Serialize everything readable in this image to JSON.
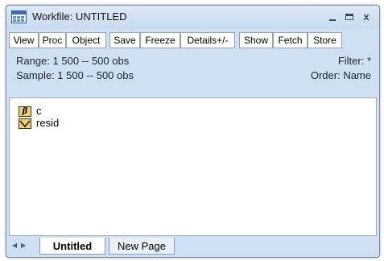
{
  "window": {
    "title": "Workfile: UNTITLED",
    "controls": {
      "minimize": "_",
      "maximize": "□",
      "close": "X"
    }
  },
  "toolbar": {
    "buttons": [
      {
        "label": "View"
      },
      {
        "label": "Proc"
      },
      {
        "label": "Object"
      },
      {
        "label": "Save"
      },
      {
        "label": "Freeze"
      },
      {
        "label": "Details+/-"
      },
      {
        "label": "Show"
      },
      {
        "label": "Fetch"
      },
      {
        "label": "Store"
      }
    ]
  },
  "info": {
    "range": "Range:  1 500  --  500 obs",
    "sample": "Sample: 1 500  --  500 obs",
    "filter": "Filter: *",
    "order": "Order: Name"
  },
  "objects": [
    {
      "name": "c",
      "icon": "coefficient-vector-icon",
      "icon_glyph": "β"
    },
    {
      "name": "resid",
      "icon": "series-icon",
      "icon_glyph": ""
    }
  ],
  "tabs": [
    {
      "label": "Untitled",
      "active": true
    },
    {
      "label": "New Page",
      "active": false
    }
  ],
  "colors": {
    "window_background": "#cfe0f3",
    "content_background": "#ffffff",
    "object_icon_fill": "#f4d35e"
  }
}
